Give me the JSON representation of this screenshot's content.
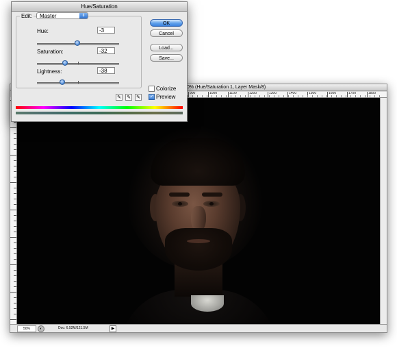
{
  "dialog": {
    "title": "Hue/Saturation",
    "edit_label": "Edit:",
    "edit_value": "Master",
    "select_arrow_icon": "updown-arrows-icon",
    "adjustments": [
      {
        "label": "Hue:",
        "value": "-3",
        "fraction": 0.49
      },
      {
        "label": "Saturation:",
        "value": "-32",
        "fraction": 0.34
      },
      {
        "label": "Lightness:",
        "value": "-38",
        "fraction": 0.31
      }
    ],
    "buttons": {
      "ok": "OK",
      "cancel": "Cancel",
      "load": "Load...",
      "save": "Save..."
    },
    "colorize_label": "Colorize",
    "colorize_checked": false,
    "preview_label": "Preview",
    "preview_checked": true,
    "eyedropper_icons": [
      "eyedropper-icon",
      "eyedropper-plus-icon",
      "eyedropper-minus-icon"
    ]
  },
  "document": {
    "title_suffix": "0% (Hue/Saturation 1, Layer Mask/8)",
    "ruler_top_labels": [
      "900",
      "1000",
      "1100",
      "1200",
      "1300",
      "1400",
      "1500",
      "1600",
      "1700",
      "1800"
    ],
    "zoom": "50%",
    "doc_info": "Doc: 6.52M/121.5M",
    "status_arrow_icon": "triangle-right-icon"
  },
  "colors": {
    "canvas_background": "#030303",
    "dialog_background": "#e9e9e9",
    "primary_button": "#3c82de"
  }
}
